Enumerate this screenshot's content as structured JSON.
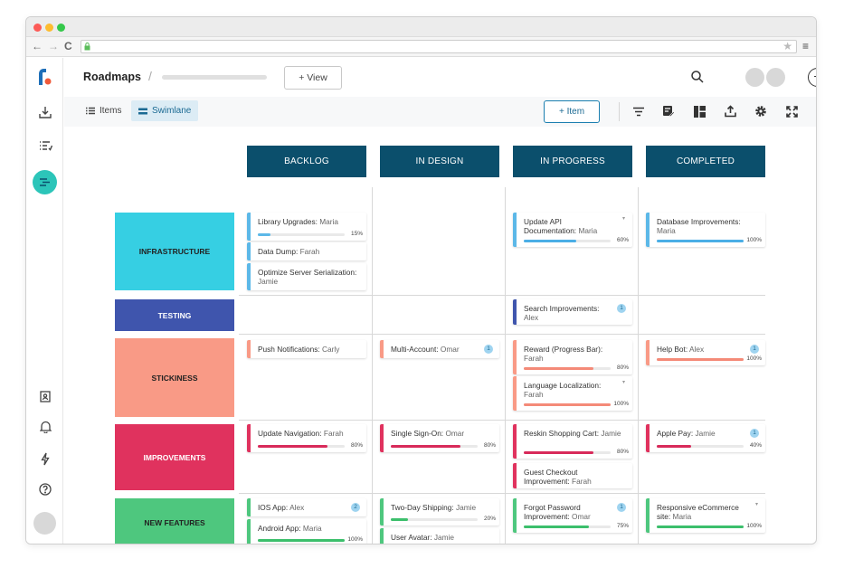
{
  "browser": {
    "back": "←",
    "forward": "→",
    "reload": "C",
    "star": "★",
    "menu": "≡"
  },
  "header": {
    "title": "Roadmaps",
    "separator": "/",
    "view_button": "+ View"
  },
  "toolbar": {
    "tabs": [
      {
        "label": "Items",
        "icon": "list-icon"
      },
      {
        "label": "Swimlane",
        "icon": "swimlane-icon",
        "active": true
      }
    ],
    "add_item_label": "+ Item",
    "icons": [
      "filter-icon",
      "edit-list-icon",
      "layout-icon",
      "export-icon",
      "settings-icon",
      "fullscreen-icon"
    ]
  },
  "columns": [
    "BACKLOG",
    "IN DESIGN",
    "IN PROGRESS",
    "COMPLETED"
  ],
  "lanes": [
    {
      "label": "INFRASTRUCTURE",
      "color": "#36cfe3"
    },
    {
      "label": "TESTING",
      "color": "#3f55ad"
    },
    {
      "label": "STICKINESS",
      "color": "#f99a86"
    },
    {
      "label": "IMPROVEMENTS",
      "color": "#e0325e"
    },
    {
      "label": "NEW FEATURES",
      "color": "#4ec77e"
    }
  ],
  "cards": [
    {
      "title": "Library Upgrades:",
      "owner": "Maria",
      "progress": 15,
      "progress_label": "15%",
      "color": "#5cb8e8",
      "bar": "#5cb8e8"
    },
    {
      "title": "Data Dump:",
      "owner": "Farah",
      "color": "#5cb8e8"
    },
    {
      "title": "Optimize Server Serialization:",
      "owner": "Jamie",
      "color": "#5cb8e8"
    },
    {
      "title": "Update API Documentation:",
      "owner": "Maria",
      "progress": 60,
      "progress_label": "60%",
      "color": "#5cb8e8",
      "bar": "#4aaee6",
      "caret": "▾"
    },
    {
      "title": "Database Improvements:",
      "owner": "Maria",
      "progress": 100,
      "progress_label": "100%",
      "color": "#5cb8e8",
      "bar": "#4aaee6"
    },
    {
      "title": "Search Improvements:",
      "owner": "Alex",
      "color": "#3f55ad",
      "badge": "1"
    },
    {
      "title": "Push Notifications:",
      "owner": "Carly",
      "color": "#f99a86"
    },
    {
      "title": "Multi-Account:",
      "owner": "Omar",
      "color": "#f99a86",
      "badge": "1"
    },
    {
      "title": "Reward (Progress Bar):",
      "owner": "Farah",
      "progress": 80,
      "progress_label": "80%",
      "color": "#f99a86",
      "bar": "#f48a78"
    },
    {
      "title": "Language Localization:",
      "owner": "Farah",
      "progress": 100,
      "progress_label": "100%",
      "color": "#f99a86",
      "bar": "#f48a78",
      "caret": "▾"
    },
    {
      "title": "Help Bot:",
      "owner": "Alex",
      "progress": 100,
      "progress_label": "100%",
      "color": "#f99a86",
      "bar": "#f48a78",
      "badge": "1"
    },
    {
      "title": "Update Navigation:",
      "owner": "Farah",
      "progress": 80,
      "progress_label": "80%",
      "color": "#e0325e",
      "bar": "#d82a5a"
    },
    {
      "title": "Single Sign-On:",
      "owner": "Omar",
      "progress": 80,
      "progress_label": "80%",
      "color": "#e0325e",
      "bar": "#d82a5a"
    },
    {
      "title": "Reskin Shopping Cart:",
      "owner": "Jamie",
      "progress": 80,
      "progress_label": "80%",
      "color": "#e0325e",
      "bar": "#d82a5a"
    },
    {
      "title": "Guest Checkout Improvement:",
      "owner": "Farah",
      "color": "#e0325e"
    },
    {
      "title": "Apple Pay:",
      "owner": "Jamie",
      "progress": 40,
      "progress_label": "40%",
      "color": "#e0325e",
      "bar": "#d82a5a",
      "badge": "1"
    },
    {
      "title": "IOS App:",
      "owner": "Alex",
      "color": "#4ec77e",
      "badge": "2"
    },
    {
      "title": "Android App:",
      "owner": "Maria",
      "progress": 100,
      "progress_label": "100%",
      "color": "#4ec77e",
      "bar": "#3cbf6c"
    },
    {
      "title": "Two-Day Shipping:",
      "owner": "Jamie",
      "progress": 20,
      "progress_label": "20%",
      "color": "#4ec77e",
      "bar": "#3cbf6c"
    },
    {
      "title": "User Avatar:",
      "owner": "Jamie",
      "color": "#4ec77e"
    },
    {
      "title": "Forgot Password Improvement:",
      "owner": "Omar",
      "progress": 75,
      "progress_label": "75%",
      "color": "#4ec77e",
      "bar": "#3cbf6c",
      "badge": "1"
    },
    {
      "title": "Responsive eCommerce site:",
      "owner": "Maria",
      "progress": 100,
      "progress_label": "100%",
      "color": "#4ec77e",
      "bar": "#3cbf6c",
      "caret": "▾"
    }
  ]
}
